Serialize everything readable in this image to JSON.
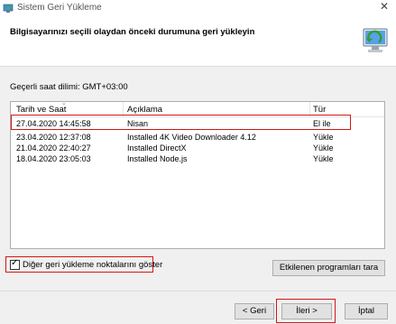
{
  "window": {
    "title": "Sistem Geri Yükleme",
    "close_glyph": "✕",
    "title_icon": "system-restore-icon"
  },
  "header": {
    "title": "Bilgisayarınızı seçili olaydan önceki durumuna geri yükleyin",
    "icon": "restore-computer-icon"
  },
  "timezone": {
    "label": "Geçerli saat dilimi: GMT+03:00"
  },
  "list": {
    "columns": [
      "Tarih ve Saat",
      "Açıklama",
      "Tür"
    ],
    "rows": [
      {
        "date": "27.04.2020 14:45:58",
        "desc": "Nisan",
        "type": "El ile"
      },
      {
        "date": "23.04.2020 12:37:08",
        "desc": "Installed 4K Video Downloader 4.12",
        "type": "Yükle"
      },
      {
        "date": "21.04.2020 22:40:27",
        "desc": "Installed DirectX",
        "type": "Yükle"
      },
      {
        "date": "18.04.2020 23:05:03",
        "desc": "Installed Node.js",
        "type": "Yükle"
      }
    ]
  },
  "options": {
    "show_more_label": "Diğer geri yükleme noktalarını göster",
    "show_more_checked": true
  },
  "buttons": {
    "affected": "Etkilenen programları tara",
    "back": "< Geri",
    "next": "İleri >",
    "cancel": "İptal"
  },
  "colors": {
    "highlight": "#d51515",
    "background": "#f0f0f0"
  }
}
